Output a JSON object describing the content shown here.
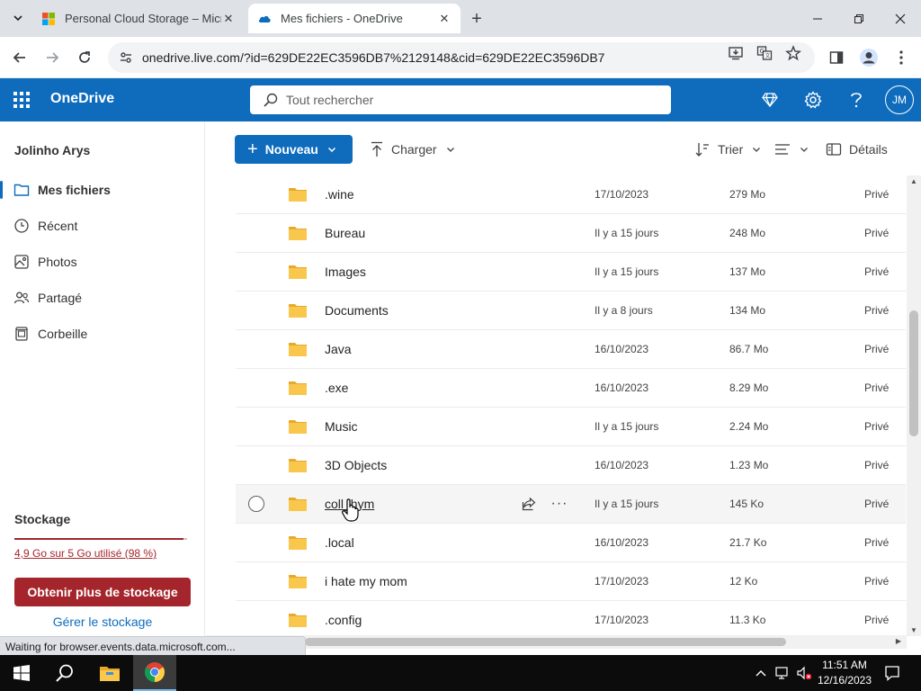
{
  "browser": {
    "tabs": [
      {
        "title": "Personal Cloud Storage – Micro",
        "active": false
      },
      {
        "title": "Mes fichiers - OneDrive",
        "active": true
      }
    ],
    "url": "onedrive.live.com/?id=629DE22EC3596DB7%2129148&cid=629DE22EC3596DB7",
    "status_text": "Waiting for browser.events.data.microsoft.com..."
  },
  "header": {
    "app_name": "OneDrive",
    "search_placeholder": "Tout rechercher",
    "avatar_initials": "JM"
  },
  "sidebar": {
    "user_name": "Jolinho Arys",
    "items": [
      {
        "label": "Mes fichiers",
        "icon": "folder-icon",
        "selected": true
      },
      {
        "label": "Récent",
        "icon": "clock-icon",
        "selected": false
      },
      {
        "label": "Photos",
        "icon": "image-icon",
        "selected": false
      },
      {
        "label": "Partagé",
        "icon": "people-icon",
        "selected": false
      },
      {
        "label": "Corbeille",
        "icon": "trash-icon",
        "selected": false
      }
    ],
    "storage": {
      "title": "Stockage",
      "usage_text": "4,9 Go sur 5 Go utilisé (98 %)",
      "used_fraction": 0.98,
      "upgrade_button": "Obtenir plus de stockage",
      "manage_link": "Gérer le stockage"
    }
  },
  "commandbar": {
    "new_label": "Nouveau",
    "upload_label": "Charger",
    "sort_label": "Trier",
    "details_label": "Détails"
  },
  "files": [
    {
      "name": ".wine",
      "modified": "17/10/2023",
      "size": "279 Mo",
      "sharing": "Privé"
    },
    {
      "name": "Bureau",
      "modified": "Il y a 15 jours",
      "size": "248 Mo",
      "sharing": "Privé"
    },
    {
      "name": "Images",
      "modified": "Il y a 15 jours",
      "size": "137 Mo",
      "sharing": "Privé"
    },
    {
      "name": "Documents",
      "modified": "Il y a 8 jours",
      "size": "134 Mo",
      "sharing": "Privé"
    },
    {
      "name": "Java",
      "modified": "16/10/2023",
      "size": "86.7 Mo",
      "sharing": "Privé"
    },
    {
      "name": ".exe",
      "modified": "16/10/2023",
      "size": "8.29 Mo",
      "sharing": "Privé"
    },
    {
      "name": "Music",
      "modified": "Il y a 15 jours",
      "size": "2.24 Mo",
      "sharing": "Privé"
    },
    {
      "name": "3D Objects",
      "modified": "16/10/2023",
      "size": "1.23 Mo",
      "sharing": "Privé"
    },
    {
      "name": "coll_hym",
      "modified": "Il y a 15 jours",
      "size": "145 Ko",
      "sharing": "Privé",
      "hover": true
    },
    {
      "name": ".local",
      "modified": "16/10/2023",
      "size": "21.7 Ko",
      "sharing": "Privé"
    },
    {
      "name": "i hate my mom",
      "modified": "17/10/2023",
      "size": "12 Ko",
      "sharing": "Privé"
    },
    {
      "name": ".config",
      "modified": "17/10/2023",
      "size": "11.3 Ko",
      "sharing": "Privé"
    }
  ],
  "taskbar": {
    "time": "11:51 AM",
    "date": "12/16/2023"
  },
  "colors": {
    "accent": "#0f6cbd",
    "danger": "#a4262c",
    "folder": "#f8c74b"
  }
}
